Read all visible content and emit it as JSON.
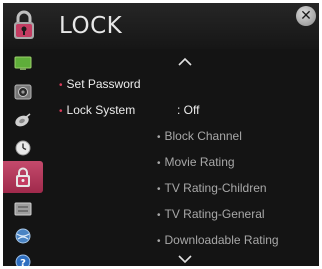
{
  "header": {
    "title": "LOCK",
    "title_icon": "lock-icon",
    "close_icon": "close-icon",
    "close_label": "✕"
  },
  "sidebar": {
    "items": [
      {
        "icon": "picture-icon"
      },
      {
        "icon": "sound-icon"
      },
      {
        "icon": "channel-icon"
      },
      {
        "icon": "time-icon"
      },
      {
        "icon": "lock-icon",
        "active": true
      },
      {
        "icon": "option-icon"
      },
      {
        "icon": "network-icon"
      },
      {
        "icon": "support-icon"
      }
    ]
  },
  "menu": {
    "scroll_up_icon": "chevron-up-icon",
    "scroll_down_icon": "chevron-down-icon",
    "set_password": {
      "label": "Set Password"
    },
    "lock_system": {
      "label": "Lock System",
      "value": ": Off"
    },
    "sub_items": [
      "Block Channel",
      "Movie Rating",
      "TV Rating-Children",
      "TV Rating-General",
      "Downloadable Rating"
    ],
    "bullet": "•"
  },
  "colors": {
    "accent": "#c43c62",
    "background": "#141414",
    "text": "#ececec",
    "disabled_text": "#a8a8a8"
  }
}
